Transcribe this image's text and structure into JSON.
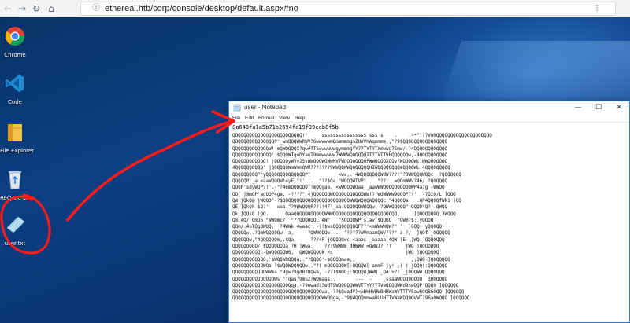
{
  "browser": {
    "url": "ethereal.htb/corp/console/desktop/default.aspx#no",
    "back_icon": "arrow-left",
    "forward_icon": "arrow-right",
    "reload_icon": "reload",
    "home_icon": "home",
    "info_icon": "info",
    "actions_icon": "more"
  },
  "desktop": {
    "icons": [
      {
        "label": "Chrome",
        "icon": "chrome-icon"
      },
      {
        "label": "Code",
        "icon": "vscode-icon"
      },
      {
        "label": "File Explorer",
        "icon": "folder-icon"
      },
      {
        "label": "Recycle bin",
        "icon": "recycle-bin-icon"
      },
      {
        "label": "user.txt",
        "icon": "text-file-icon"
      }
    ]
  },
  "notepad": {
    "title": "user - Notepad",
    "menu": [
      "File",
      "Edit",
      "Format",
      "View",
      "Help"
    ],
    "controls": {
      "minimize": "—",
      "maximize": "☐",
      "close": "✕"
    },
    "hash": "8a648fa1a5b71b2694fa19f39ceb8f5b",
    "ascii_art": [
      "QQQQQQQQQQQQQQQQQQQQQQQQQ!'  ___ssssssssssssssss_sss_s____.    .~*\"\"??VWQQQQQQQQQQQQQQQQQQQQQ",
      "QQQQQQQQQQQQQQQP'_wmQQQWWRWV?6wwwwwmQmmmmmgmZUVVHAqmmmm,,\"?9$QQQQQQQQQQQQQQQQ",
      "QQQQQQQQQQQQQW! mQWQQQQX?qw#TTSgwwwwwgymmmgYY7?TYTYTXmwwg7Smw/-?4QQQQQQQQQQQQ",
      "QQQQQQQQQQQQQQ' $QQQWTquDYauT9mmwwwww7WWWWQQQQQ@TT?TVTT9HQQQQQQw,-4QQQQQQQQQQ",
      "QQQQQQQQQQQQ! jQQQQQyWVv2SvWWQQQWQWWMV7WQQQQQQQQPWWQQQQXQQv?WQQQQWc)WWQQQQQQQ",
      "4QQQQQQQQQQ' jQQQQQQWmWmmQWU???????9WWQQWWQQQQQQQHIWQQQQQQQQmQQQQWL 4QQQQQQQQQ",
      "QQQQQQQQQP'yQQQQQQQQQQQQQQP\"          <wa,.!4WQQQQQQQWdW???!\"?3WWQQQWQQc  ?QQQQQQQ",
      "QQQQQP'_a.<aaWQQQW!<yF \"!' ..  \"??$Qa \"WQQQWTVP\"    \"??'  =QQmWWV?46/ ?QQQQQQ",
      "QQQP'sdyWQP?!'.-\"?46mQQQQQQT!mQQgaa. <wWQQQWQaa _aawWWQQQQQQQQQQWP4a7g -WWQQ",
      "QQ[ j@mQP'adQQP4ga, -????\" <jQQQQQQWQQQQQQQQQQQWW();WQWWWW9QQQP??'  -?QzQ/L ]QQQ",
      "QW jQkQ@ jWQQD'-?$QQQQQQQQQQQQQQQQQQQQQQQQWWQWQQQWQQQQc \"4QQQQa   .QP4QQQQfWk1 ]QQ",
      "QE ]QkQk $Q?'   waa \"?9WWQQQP???!47'_aa.QQQQQQWWQQw,-?QWWQQQQQ\"'QQQD\\Q?(.QWQQ",
      "Qk ]QQkQ )QQ.      QaaQQQQQQQQQQQWWWQQQQQQQQQQQQQQQQQQQQQQQ.     ]QQQQQQQQ.3WQQQ",
      "Qm.4Q/ QmQ6 \"WWQmc/  \"??QQQQQQL 4W\"   \"$QQQQWP's,avT$QQQQ  \"QW@?$:.yQQQQ",
      "QQm/.4uTQgQWQQ,  ?4WWk 4waac  -??$wsQQQQQQQQQF??'<mWWWWQW?\" '  ]6QQ' yQQQQQ",
      "QQQQQw,.?QmWQQQQQw  a,     ?QWWQQQw  .  \"?????WVmaamQWV???\" a ?/  ]QQf jQQQQQQ",
      "QQQQQQw,\"4QQQQQQm,.$Qa      ???4F jQQQQQwc <aaas _aaaaa 4QW )E  ]WQ'-QQQQQQQ",
      "QQQQQQQQQ/ $QQQQQQQa ?H ]Wwa,    ???9WWWm dQWWW,=QWWJ? ?!     jWQ ]QQQQQQQ",
      "QQQQQQQQQQc-QWQQQQQW6,  QWQWQQQQk <c                          jWQ ]QQQQQQQ",
      "QQQQQQQQQQQQ,'$WQQWQQQQg,.\"?QQQQ'-mQQQQmaa,,                    ,;QWQ-]QQQQQQQ",
      "QQQQQQQQQQQWQa ?$WQQWQQQQQw,.\"?( mQQQQQQW[:QQQQW[ ammF jy! ;( ) jQQQ(:QQQQQQQ",
      "QQQQQQQQQQQQWWma \"9gw?9gdB?QQwa, -??T$WQQ;:QQQQW]WWQ _Q# +?! _jQQQW# QQQQQQQ",
      "QQQQQQQQQQQQQQQWs \"Tqau?9muZ?WQmaas,,       ---  -    _ssaaWQQQQQQQQ  3QQQQQQ",
      "QQQQQQQQQQQQQQQQQQQQQga,-?9mwad?3wdT9WQQQQQWWVTTYY?YTVwQQQQWWd9$wQQP'QQQQ ]QQQQQQ",
      "QQQQQQQQQQQQQQQQQQQQQQQQQQQQQQQQwa,-??$QwadV)<vBHHVHWBHHWaWVTTTV5awRQQB6QQQ ]QQQQQQ",
      "QQQQQQQQQQQQQQQQQQQQQQQQQQQQQQQQWWQQga,-\"9$WQQQmmwaBUUHTTVWaWQQQQVWT?96aQWQQQ ]QQQQQQ"
    ]
  },
  "annotation": {
    "color": "#ff1a1a"
  }
}
